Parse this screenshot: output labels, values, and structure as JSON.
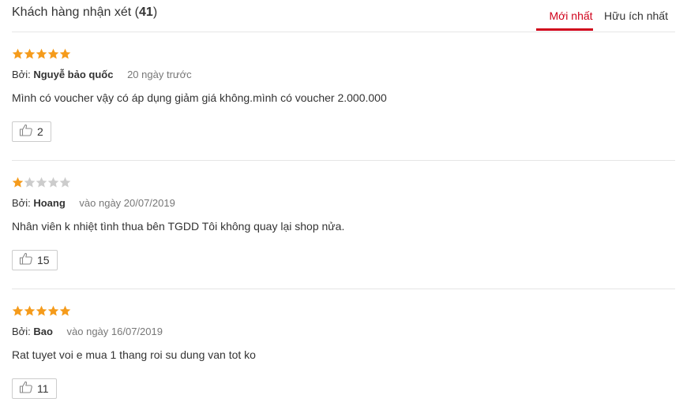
{
  "header": {
    "title_prefix": "Khách hàng nhận xét (",
    "count": "41",
    "title_suffix": ")",
    "tabs": [
      {
        "label": "Mới nhất",
        "active": true
      },
      {
        "label": "Hữu ích nhất",
        "active": false
      }
    ]
  },
  "colors": {
    "accent": "#d0021b",
    "star_on": "#f59b1b",
    "star_off": "#cccccc"
  },
  "reviews": [
    {
      "rating": 5,
      "by_label": "Bởi:",
      "author": "Nguyễ bảo quốc",
      "date": "20 ngày trước",
      "content": "Mình có voucher vậy có áp dụng giảm giá không.mình có voucher 2.000.000",
      "likes": "2"
    },
    {
      "rating": 1,
      "by_label": "Bởi:",
      "author": "Hoang",
      "date": "vào ngày 20/07/2019",
      "content": "Nhân viên k nhiệt tình thua bên TGDD Tôi không quay lại shop nửa.",
      "likes": "15"
    },
    {
      "rating": 5,
      "by_label": "Bởi:",
      "author": "Bao",
      "date": "vào ngày 16/07/2019",
      "content": "Rat tuyet voi e mua 1 thang roi su dung van tot ko",
      "likes": "11"
    }
  ]
}
